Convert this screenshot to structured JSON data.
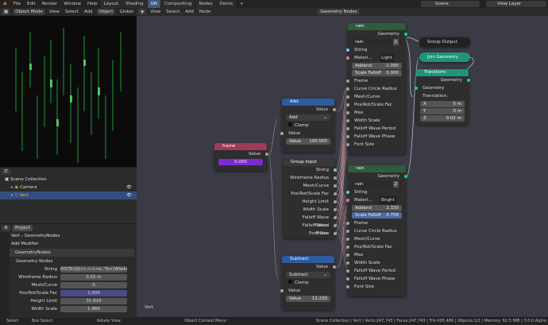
{
  "menu": [
    "File",
    "Edit",
    "Render",
    "Window",
    "Help"
  ],
  "workspaces": [
    "Layout",
    "Shading",
    "GN",
    "Compositing",
    "Nodes",
    "Demo"
  ],
  "active_workspace": "GN",
  "scene": "Scene",
  "view_layer": "View Layer",
  "viewport_header": {
    "mode": "Object Mode",
    "items": [
      "View",
      "Select",
      "Add",
      "Object"
    ],
    "orient": "Global"
  },
  "node_header": {
    "items": [
      "View",
      "Select",
      "Add",
      "Node"
    ],
    "tree": "Geometry Nodes"
  },
  "outliner": {
    "title": "Scene Collection",
    "items": [
      "Camera",
      "Vert"
    ]
  },
  "props": {
    "tab": "Project",
    "obj": "Vert",
    "modifier_name": "GeometryNodes",
    "add_modifier": "Add Modifier",
    "mod": "GeometryNodes",
    "group": "Geometry Nodes",
    "rows": [
      [
        "String",
        "DO\\Tc\\\\Q;r>;><>o..*b+)Wlwkqa;?'n"
      ],
      [
        "Wireframe Radius",
        "0.02 m"
      ],
      [
        "Mesh/Curve",
        "0"
      ],
      [
        "Pos/Rot/Scale Fac",
        "1.000"
      ],
      [
        "Height Limit",
        "31.810"
      ],
      [
        "Width Scale",
        "1.960"
      ]
    ]
  },
  "nodes": {
    "rain1": {
      "title": "rain",
      "group": "rain",
      "users": "2",
      "out": "Geometry",
      "string": "String",
      "material": "Materi...",
      "light": "Light",
      "addend_l": "Addend",
      "addend_v": "-1.090",
      "sf_l": "Scale Falloff",
      "sf_v": "0.000",
      "inputs": [
        "Frame",
        "Curve Circle Radius",
        "Mesh/Curve",
        "Pos/Rot/Scale Fac",
        "Max",
        "Width Scale",
        "Falloff Wave Period",
        "Falloff Wave Phase",
        "Font Size"
      ]
    },
    "rain2": {
      "title": "rain",
      "group": "rain",
      "users": "2",
      "out": "Geometry",
      "string": "String",
      "material": "Materi...",
      "light": "Bright",
      "addend_l": "Addend",
      "addend_v": "2.330",
      "sf_l": "Scale Falloff",
      "sf_v": "0.758",
      "inputs": [
        "Frame",
        "Curve Circle Radius",
        "Mesh/Curve",
        "Pos/Rot/Scale Fac",
        "Max",
        "Width Scale",
        "Falloff Wave Period",
        "Falloff Wave Phase",
        "Font Size"
      ]
    },
    "group_output": "Group Output",
    "join": "Join Geometry",
    "transform": {
      "title": "Transform",
      "out": "Geometry",
      "geo": "Geometry",
      "trans": "Translation:",
      "x_l": "X",
      "x": "0 m",
      "y_l": "Y",
      "y": "0 m",
      "z_l": "Z",
      "z": "0.02 m"
    },
    "add": {
      "title": "Add",
      "out": "Value",
      "op": "Add",
      "clamp": "Clamp",
      "in": "Value",
      "val_l": "Value",
      "val": "100.000"
    },
    "frame": {
      "title": "frame",
      "out": "Value",
      "val": "0.000"
    },
    "group_input": {
      "title": "Group Input",
      "outputs": [
        "String",
        "Wireframe Radius",
        "Mesh/Curve",
        "Pos/Rot/Scale Fac",
        "Height Limit",
        "Width Scale",
        "Falloff Wave Period",
        "Falloff Wave Phase",
        "Font Size"
      ]
    },
    "subtract": {
      "title": "Subtract",
      "out": "Value",
      "op": "Subtract",
      "clamp": "Clamp",
      "in": "Value",
      "val_l": "Value",
      "val": "13.230"
    }
  },
  "editor_label": "Vert",
  "status": {
    "left": [
      "Select",
      "Box Select",
      "Rotate View",
      "Object Context Menu"
    ],
    "right": "Scene Collection | Vert | Verts:247,743 | Faces:247,743 | Tris:495,486 | Objects:1/2 | Memory: 62.5 MiB | 3.0.0 Alpha"
  }
}
